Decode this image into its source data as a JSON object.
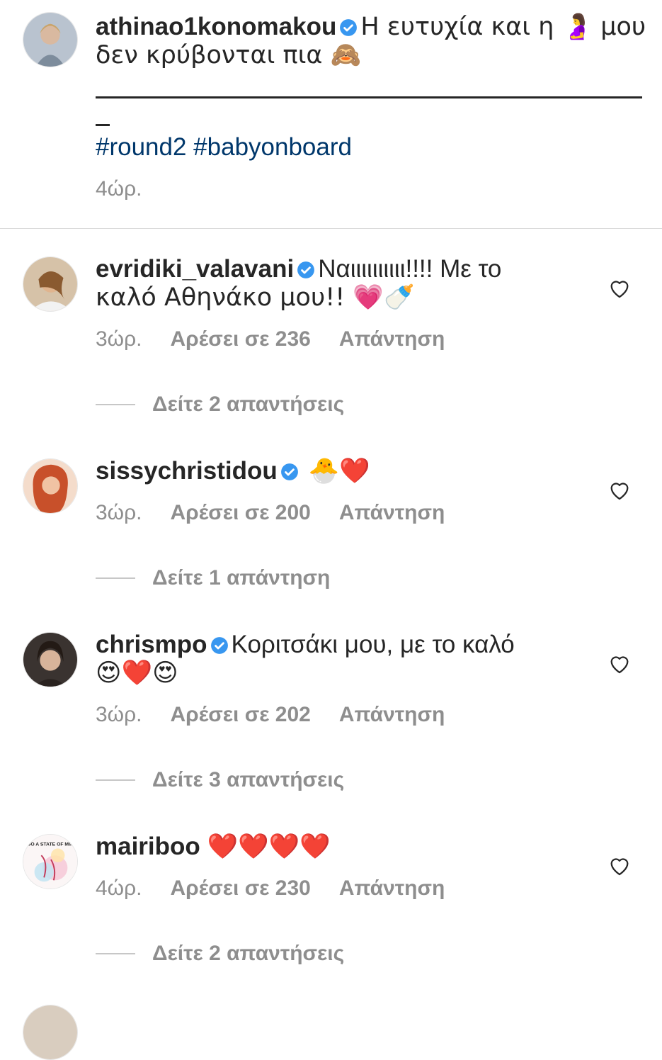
{
  "post": {
    "username": "athinao1konomakou",
    "caption_line1": "Η ευτυχία και η 🤰 μου",
    "caption_line2": "δεν κρύβονται πια 🙈",
    "hashtags": "#round2 #babyonboard",
    "time": "4ώρ."
  },
  "comments": [
    {
      "username": "evridiki_valavani",
      "text_line1": "Ναιιιιιιιιιι!!!! Με το",
      "text_line2": "καλό Αθηνάκο μου!! 💗🍼",
      "time": "3ώρ.",
      "likes": "Αρέσει σε 236",
      "reply_label": "Απάντηση",
      "view_replies": "Δείτε 2 απαντήσεις"
    },
    {
      "username": "sissychristidou",
      "text_line1": "🐣❤️",
      "time": "3ώρ.",
      "likes": "Αρέσει σε 200",
      "reply_label": "Απάντηση",
      "view_replies": "Δείτε 1 απάντηση"
    },
    {
      "username": "chrismpo",
      "text_line1": "Κοριτσάκι μου, με το καλό",
      "text_line2": "😍❤️😍",
      "time": "3ώρ.",
      "likes": "Αρέσει σε 202",
      "reply_label": "Απάντηση",
      "view_replies": "Δείτε 3 απαντήσεις"
    },
    {
      "username": "mairiboo",
      "text_line1": "❤️❤️❤️❤️",
      "time": "4ώρ.",
      "likes": "Αρέσει σε 230",
      "reply_label": "Απάντηση",
      "view_replies": "Δείτε 2 απαντήσεις",
      "avatar_text": "BOO A STATE OF MIND"
    }
  ],
  "colors": {
    "verified": "#3897f0",
    "link": "#00376b",
    "muted": "#8e8e8e",
    "heart": "#e0245e"
  }
}
